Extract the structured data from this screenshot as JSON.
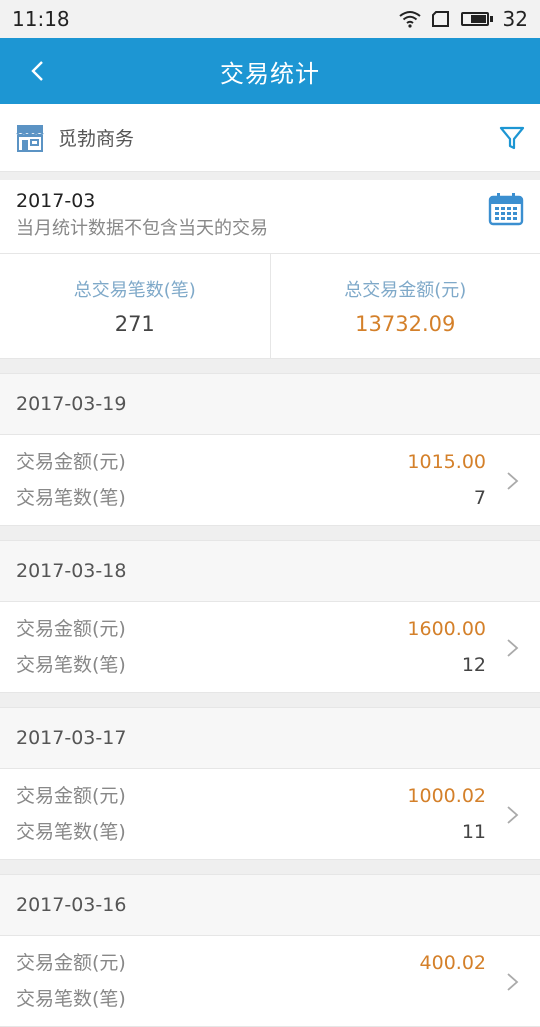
{
  "status": {
    "time": "11:18",
    "battery": "32"
  },
  "appbar": {
    "title": "交易统计"
  },
  "merchant": {
    "name": "觅勃商务"
  },
  "month": {
    "label": "2017-03",
    "note": "当月统计数据不包含当天的交易"
  },
  "totals": {
    "count_label": "总交易笔数(笔)",
    "count_value": "271",
    "amount_label": "总交易金额(元)",
    "amount_value": "13732.09"
  },
  "colors": {
    "primary": "#1d96d3",
    "amount": "#d4802a",
    "label_blue": "#7fa9c9"
  },
  "days": [
    {
      "date": "2017-03-19",
      "amount_label": "交易金额(元)",
      "amount": "1015.00",
      "count_label": "交易笔数(笔)",
      "count": "7"
    },
    {
      "date": "2017-03-18",
      "amount_label": "交易金额(元)",
      "amount": "1600.00",
      "count_label": "交易笔数(笔)",
      "count": "12"
    },
    {
      "date": "2017-03-17",
      "amount_label": "交易金额(元)",
      "amount": "1000.02",
      "count_label": "交易笔数(笔)",
      "count": "11"
    },
    {
      "date": "2017-03-16",
      "amount_label": "交易金额(元)",
      "amount": "400.02",
      "count_label": "交易笔数(笔)",
      "count": ""
    }
  ]
}
